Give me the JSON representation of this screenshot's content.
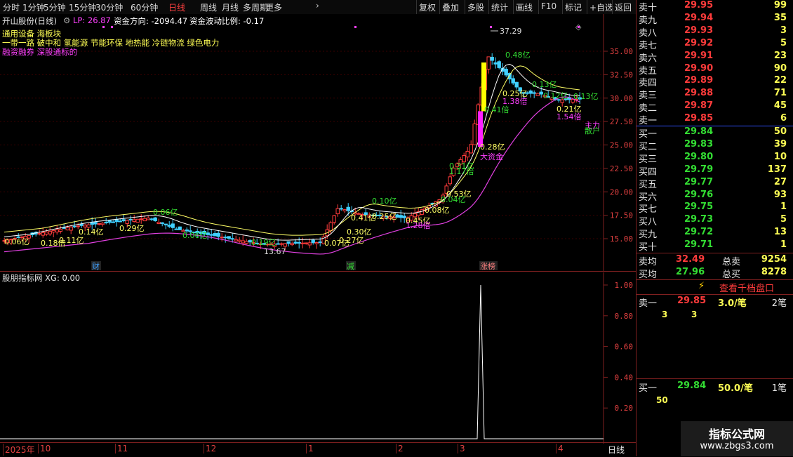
{
  "toolbar": {
    "periods": [
      "分时",
      "1分钟",
      "5分钟",
      "15分钟",
      "30分钟",
      "60分钟",
      "日线",
      "周线",
      "月线",
      "多周期",
      "更多"
    ],
    "active_period": "日线",
    "actions": [
      "复权",
      "叠加",
      "多股",
      "统计",
      "画线",
      "F10",
      "标记",
      "+自选",
      "返回"
    ]
  },
  "main": {
    "stock_title": "开山股份(日线)",
    "lp_label": "LP: 26.87",
    "fund_direction": "资金方向: -2094.47",
    "fund_volatility": "资金波动比例: -0.17",
    "info_lines": [
      "通用设备 海板块",
      "一带一路 破中和 氢能源 节能环保 地热能 冷链物流 绿色电力",
      "融资融券 深股通标的"
    ],
    "y_axis": [
      "35.00",
      "32.50",
      "30.00",
      "27.50",
      "25.00",
      "22.50",
      "20.00",
      "17.50",
      "15.00"
    ],
    "annotations": [
      {
        "t": "37.29",
        "c": "#dddddd"
      },
      {
        "t": "13.67",
        "c": "#dddddd"
      },
      {
        "t": "0.48亿",
        "c": "#33dd33"
      },
      {
        "t": "0.13亿",
        "c": "#33dd33"
      },
      {
        "t": "0.25亿",
        "c": "#ffff66"
      },
      {
        "t": "1.38倍",
        "c": "#ff40ff"
      },
      {
        "t": "0.12亿",
        "c": "#33dd33"
      },
      {
        "t": "0.21亿",
        "c": "#ffff66"
      },
      {
        "t": "1.54倍",
        "c": "#ff40ff"
      },
      {
        "t": "0.13亿",
        "c": "#33dd33"
      },
      {
        "t": "0.41倍",
        "c": "#33dd33"
      },
      {
        "t": "0.28亿",
        "c": "#ffff66"
      },
      {
        "t": "大资金",
        "c": "#ff40ff"
      },
      {
        "t": "0.31亿",
        "c": "#33dd33"
      },
      {
        "t": "1.17倍",
        "c": "#33dd33"
      },
      {
        "t": "0.53亿",
        "c": "#ffff66"
      },
      {
        "t": "0.04亿",
        "c": "#33dd33"
      },
      {
        "t": "0.08亿",
        "c": "#ffff66"
      },
      {
        "t": "0.45亿",
        "c": "#ffff66"
      },
      {
        "t": "1.28倍",
        "c": "#ff40ff"
      },
      {
        "t": "0.10亿",
        "c": "#33dd33"
      },
      {
        "t": "0.41亿",
        "c": "#ffff66"
      },
      {
        "t": "0.25亿",
        "c": "#ffff66"
      },
      {
        "t": "0.30亿",
        "c": "#ffff66"
      },
      {
        "t": "0.27亿",
        "c": "#ffff66"
      },
      {
        "t": "0.07亿",
        "c": "#ffff66"
      },
      {
        "t": "0.19亿",
        "c": "#33dd33"
      },
      {
        "t": "0.06亿",
        "c": "#33dd33"
      },
      {
        "t": "0.06亿",
        "c": "#33dd33"
      },
      {
        "t": "0.29亿",
        "c": "#ffff66"
      },
      {
        "t": "0.14亿",
        "c": "#ffff66"
      },
      {
        "t": "0.11亿",
        "c": "#ffff66"
      },
      {
        "t": "0.06亿",
        "c": "#ffff66"
      },
      {
        "t": "0.18倍",
        "c": "#ffff66"
      },
      {
        "t": "主力",
        "c": "#ff40ff"
      },
      {
        "t": "散户",
        "c": "#33dd33"
      }
    ],
    "markers": [
      {
        "t": "财",
        "c": "#40a0ff"
      },
      {
        "t": "减",
        "c": "#33dd33"
      },
      {
        "t": "涨榜",
        "c": "#ff8080"
      }
    ]
  },
  "indicator": {
    "title": "股朋指标网 XG: 0.00",
    "y_axis": [
      "1.00",
      "0.80",
      "0.60",
      "0.40",
      "0.20"
    ]
  },
  "time_axis": {
    "labels": [
      "2025年",
      "10",
      "11",
      "12",
      "1",
      "2",
      "3",
      "4"
    ],
    "period": "日线"
  },
  "orderbook": {
    "asks": [
      {
        "label": "卖十",
        "price": "29.95",
        "vol": "99"
      },
      {
        "label": "卖九",
        "price": "29.94",
        "vol": "35"
      },
      {
        "label": "卖八",
        "price": "29.93",
        "vol": "3"
      },
      {
        "label": "卖七",
        "price": "29.92",
        "vol": "5"
      },
      {
        "label": "卖六",
        "price": "29.91",
        "vol": "23"
      },
      {
        "label": "卖五",
        "price": "29.90",
        "vol": "90"
      },
      {
        "label": "卖四",
        "price": "29.89",
        "vol": "22"
      },
      {
        "label": "卖三",
        "price": "29.88",
        "vol": "71"
      },
      {
        "label": "卖二",
        "price": "29.87",
        "vol": "45"
      },
      {
        "label": "卖一",
        "price": "29.85",
        "vol": "6"
      }
    ],
    "bids": [
      {
        "label": "买一",
        "price": "29.84",
        "vol": "50"
      },
      {
        "label": "买二",
        "price": "29.83",
        "vol": "39"
      },
      {
        "label": "买三",
        "price": "29.80",
        "vol": "10"
      },
      {
        "label": "买四",
        "price": "29.79",
        "vol": "137"
      },
      {
        "label": "买五",
        "price": "29.77",
        "vol": "27"
      },
      {
        "label": "买六",
        "price": "29.76",
        "vol": "93"
      },
      {
        "label": "买七",
        "price": "29.75",
        "vol": "1"
      },
      {
        "label": "买八",
        "price": "29.73",
        "vol": "5"
      },
      {
        "label": "买九",
        "price": "29.72",
        "vol": "13"
      },
      {
        "label": "买十",
        "price": "29.71",
        "vol": "1"
      }
    ],
    "avg_sell_label": "卖均",
    "avg_sell": "32.49",
    "total_sell_label": "总卖",
    "total_sell": "9254",
    "avg_buy_label": "买均",
    "avg_buy": "27.96",
    "total_buy_label": "总买",
    "total_buy": "8278",
    "depth_button": "查看千档盘口",
    "sell1_detail": {
      "label": "卖一",
      "price": "29.85",
      "avg": "3.0/笔",
      "count": "2笔",
      "orders": [
        "3",
        "3"
      ]
    },
    "buy1_detail": {
      "label": "买一",
      "price": "29.84",
      "avg": "50.0/笔",
      "count": "1笔",
      "orders": [
        "50"
      ]
    }
  },
  "watermark": {
    "line1": "指标公式网",
    "line2": "www.zbgs3.com"
  }
}
